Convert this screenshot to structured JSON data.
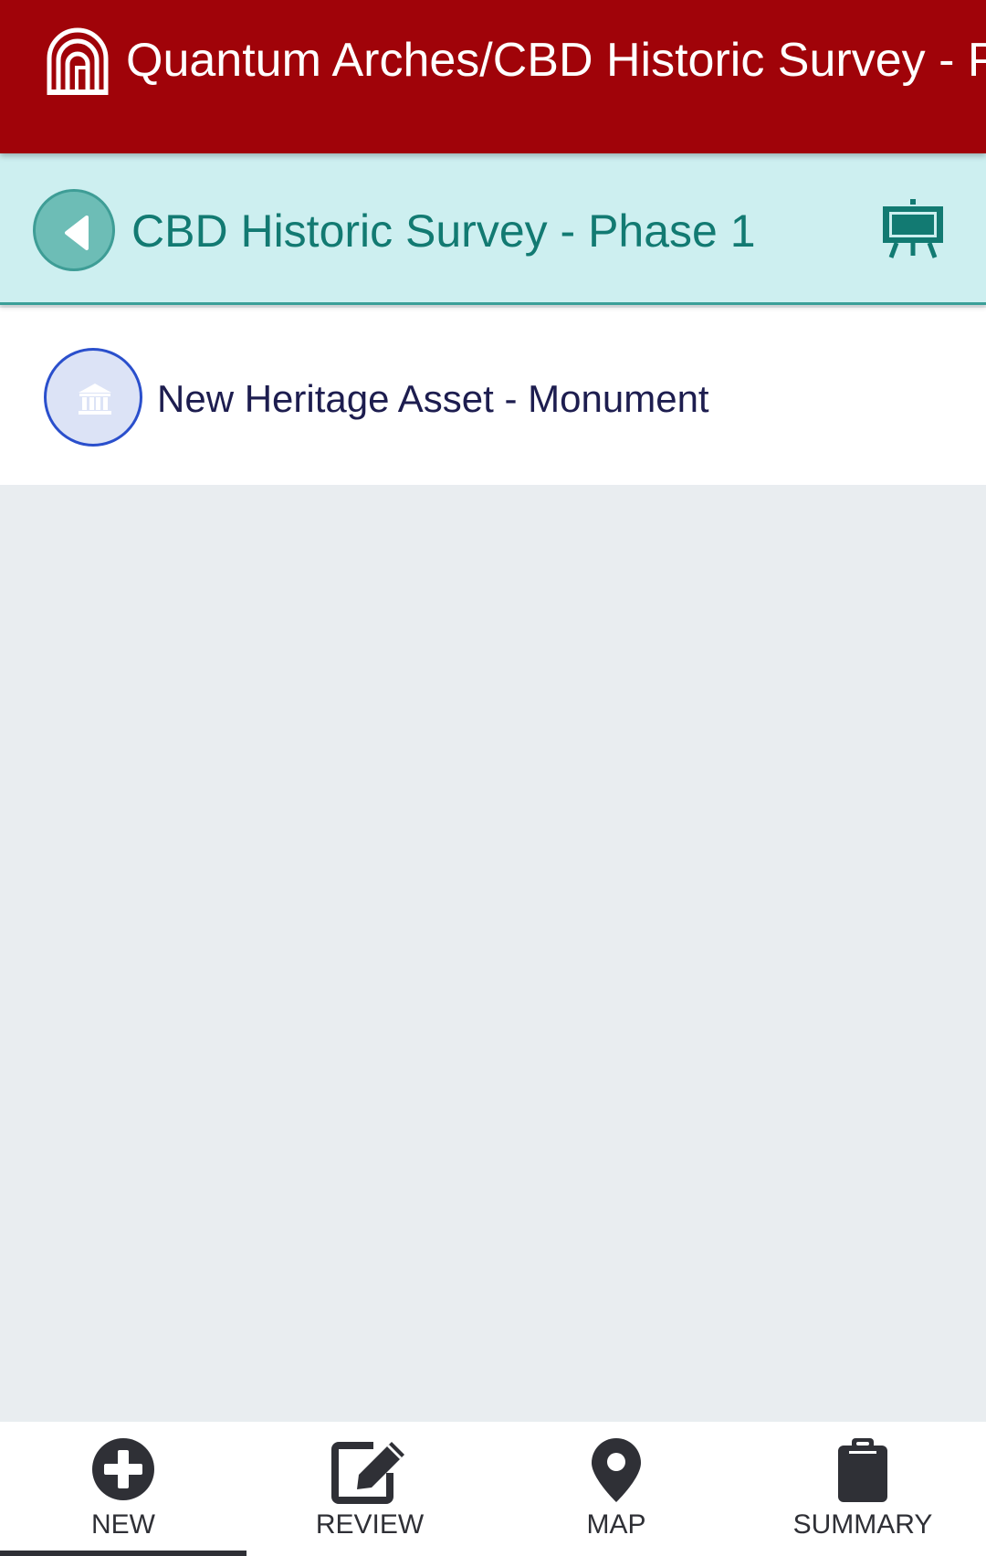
{
  "app": {
    "title": "Quantum Arches/CBD Historic Survey - Ph",
    "logo": "arches-logo",
    "bar_color": "#a00309"
  },
  "project": {
    "title": "CBD Historic Survey - Phase 1",
    "back_icon": "back-arrow-icon",
    "action_icon": "easel-icon",
    "accent_color": "#127a72",
    "header_bg": "#cdeff0"
  },
  "list": {
    "items": [
      {
        "label": "New Heritage Asset - Monument",
        "icon": "monument-icon"
      }
    ]
  },
  "tabs": [
    {
      "label": "NEW",
      "icon": "plus-circle-icon",
      "active": true
    },
    {
      "label": "REVIEW",
      "icon": "edit-icon",
      "active": false
    },
    {
      "label": "MAP",
      "icon": "map-pin-icon",
      "active": false
    },
    {
      "label": "SUMMARY",
      "icon": "clipboard-icon",
      "active": false
    }
  ]
}
